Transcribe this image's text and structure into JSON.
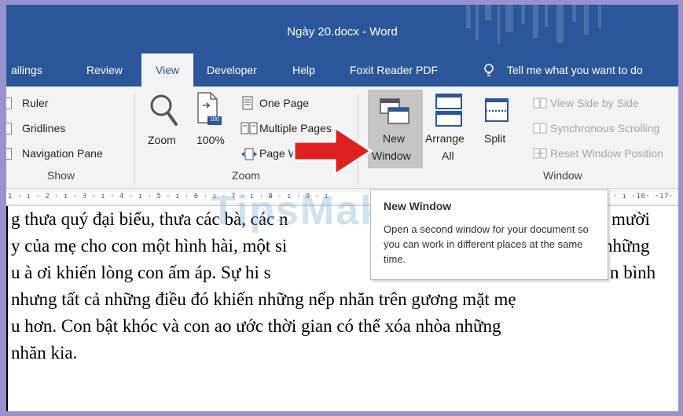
{
  "window": {
    "title": "Ngày 20.docx  -  Word"
  },
  "tabs": [
    {
      "id": "mailings",
      "label": "ailings"
    },
    {
      "id": "review",
      "label": "Review"
    },
    {
      "id": "view",
      "label": "View",
      "active": true
    },
    {
      "id": "developer",
      "label": "Developer"
    },
    {
      "id": "help",
      "label": "Help"
    },
    {
      "id": "foxit",
      "label": "Foxit Reader PDF"
    },
    {
      "id": "tell",
      "label": "Tell me what you want to do"
    }
  ],
  "ribbon": {
    "show": {
      "label": "Show",
      "items": {
        "ruler": "Ruler",
        "gridlines": "Gridlines",
        "navigation": "Navigation Pane"
      }
    },
    "zoom": {
      "label": "Zoom",
      "zoom_btn": "Zoom",
      "hundred_btn": "100%",
      "hundred_badge": "100",
      "one_page": "One Page",
      "multiple_pages": "Multiple Pages",
      "page_width": "Page Width"
    },
    "window": {
      "label": "Window",
      "new_window_line1": "New",
      "new_window_line2": "Window",
      "arrange_line1": "Arrange",
      "arrange_line2": "All",
      "split": "Split",
      "side_by_side": "View Side by Side",
      "sync_scroll": "Synchronous Scrolling",
      "reset_pos": "Reset Window Position"
    }
  },
  "ruler": {
    "left_marks": "1 · ı · 2 · ı · 3 · ı · 4 · ı · 5 · ı · 6 · ı · 7 · ı · 8 · ı · 9 · ı",
    "right_marks": "· ı ·16· ·17·"
  },
  "tooltip": {
    "title": "New Window",
    "body": "Open a second window for your document so you can work in different places at the same time."
  },
  "watermark": "TipsMake",
  "document": {
    "lines": [
      "g thưa quý đại biểu, thưa các bà, các n",
      "y của mẹ cho con một hình hài, một si",
      "u à ơi khiến lòng con ấm áp. Sự hi s",
      "nhưng tất cả những điều đó khiến những nếp nhăn trên gương mặt mẹ",
      "u hơn. Con bật khóc và con ao ước thời gian có thể xóa nhòa những",
      "nhăn kia."
    ],
    "right_fragments": [
      "mười",
      "những",
      "n bình"
    ]
  },
  "colors": {
    "ribbon_blue": "#2b579a",
    "ribbon_bg": "#f3f3f3",
    "arrow_red": "#e02020",
    "frame": "#9a92d0"
  }
}
